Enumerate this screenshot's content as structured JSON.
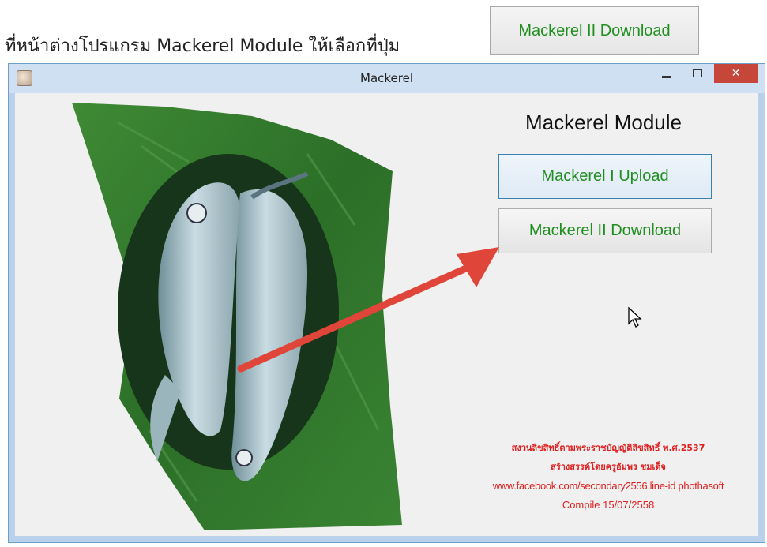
{
  "instruction": {
    "text": "ที่หน้าต่างโปรแกรม Mackerel Module ให้เลือกที่ปุ่ม",
    "sample_button_label": "Mackerel II Download"
  },
  "window": {
    "title": "Mackerel",
    "icon": "app-logo-icon",
    "controls": {
      "minimize": "minimize-icon",
      "maximize": "maximize-icon",
      "close_glyph": "✕"
    }
  },
  "form": {
    "heading": "Mackerel Module",
    "buttons": {
      "upload": "Mackerel I Upload",
      "download": "Mackerel II Download"
    }
  },
  "credits": {
    "line1": "สงวนลิขสิทธิ์ตามพระราชบัญญัติลิขสิทธิ์ พ.ศ.2537",
    "line2": "สร้างสรรค์โดยครูอัมพร ชมเด็จ",
    "line3": "www.facebook.com/secondary2556 line-id phothasoft",
    "line4": "Compile 15/07/2558"
  },
  "colors": {
    "button_text": "#1f8f1f",
    "credit_text": "#e02020",
    "arrow": "#e0453a",
    "leaf": "#2f7a2a",
    "close_button": "#c7463a"
  }
}
